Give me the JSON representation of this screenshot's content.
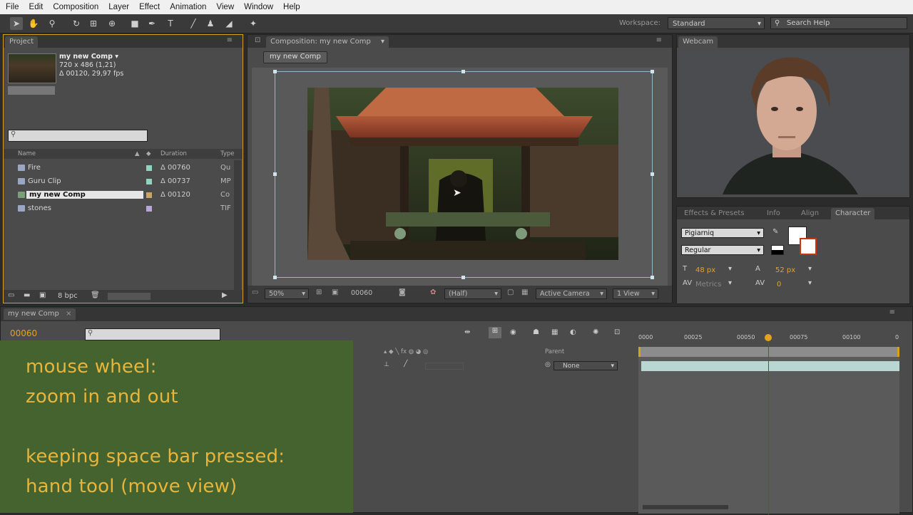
{
  "menubar": {
    "items": [
      "File",
      "Edit",
      "Composition",
      "Layer",
      "Effect",
      "Animation",
      "View",
      "Window",
      "Help"
    ]
  },
  "toolbar": {
    "workspace_label": "Workspace:",
    "workspace_value": "Standard",
    "search_placeholder": "Search Help"
  },
  "project": {
    "tab": "Project",
    "selected_name": "my new Comp ▾",
    "selected_size": "720 x 486 (1,21)",
    "selected_duration": "Δ 00120, 29,97 fps",
    "columns": {
      "name": "Name",
      "duration": "Duration",
      "type": "Type"
    },
    "files": [
      {
        "name": "Fire",
        "duration": "Δ 00760",
        "type": "Qu",
        "swatch": "#8fd3c0"
      },
      {
        "name": "Guru Clip",
        "duration": "Δ 00737",
        "type": "MP",
        "swatch": "#8fd3c0"
      },
      {
        "name": "my new Comp",
        "duration": "Δ 00120",
        "type": "Co",
        "swatch": "#c9a46a"
      },
      {
        "name": "stones",
        "duration": "",
        "type": "TIF",
        "swatch": "#b8a7d8"
      }
    ],
    "bpc": "8 bpc"
  },
  "comp": {
    "tab": "Composition: my new Comp",
    "sub_tab": "my new Comp",
    "zoom": "50%",
    "timecode": "00060",
    "resolution": "(Half)",
    "camera": "Active Camera",
    "views": "1 View"
  },
  "webcam": {
    "tab": "Webcam"
  },
  "character": {
    "tabs": [
      "Effects & Presets",
      "Info",
      "Align",
      "Character"
    ],
    "font": "Pigiarniq",
    "style": "Regular",
    "size": "48 px",
    "leading": "52 px",
    "kerning": "Metrics",
    "tracking": "0"
  },
  "timeline": {
    "tab": "my new Comp",
    "current_time": "00060",
    "ruler_ticks": [
      "0000",
      "00025",
      "00050",
      "00075",
      "00100",
      "0"
    ],
    "columns": {
      "parent": "Parent"
    },
    "layer_parent": "None",
    "playhead_frame": 60
  },
  "overlay": {
    "line1": "mouse wheel:",
    "line2": "zoom in and out",
    "line3": "keeping space bar pressed:",
    "line4": "hand tool (move view)"
  },
  "colors": {
    "accent": "#e3a321",
    "overlay_bg": "#44632e",
    "playhead": "#e01818"
  }
}
